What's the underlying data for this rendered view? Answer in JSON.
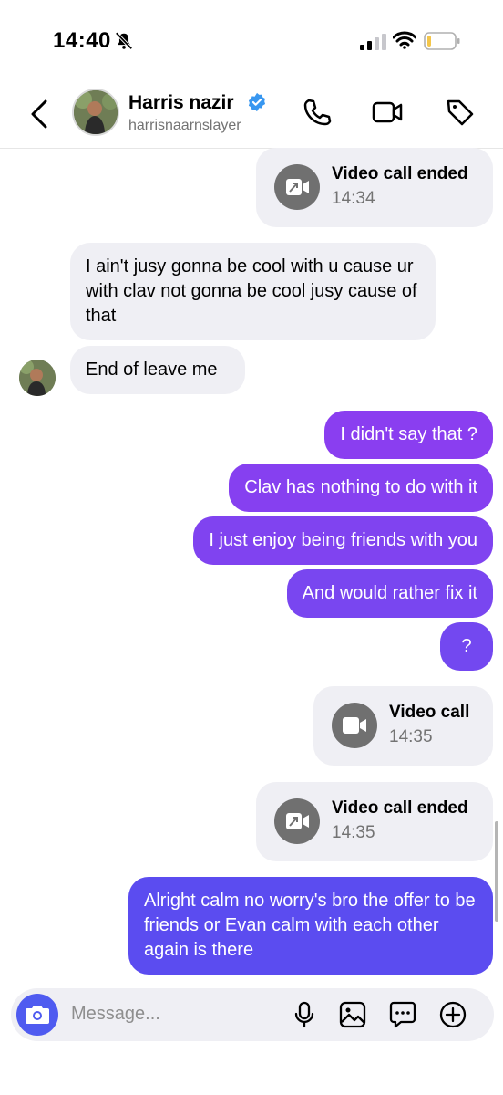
{
  "status_bar": {
    "time": "14:40"
  },
  "header": {
    "name": "Harris nazir",
    "handle": "harrisnaarnslayer"
  },
  "messages": {
    "call1": {
      "title": "Video call ended",
      "time": "14:34"
    },
    "in1": "I ain't jusy gonna be cool with u cause ur with clav not gonna be cool jusy cause of that",
    "in2": "End of leave me",
    "out1": "I didn't say that ?",
    "out2": "Clav has nothing to do with it",
    "out3": "I just enjoy being friends with you",
    "out4": "And would rather fix it",
    "out5": "?",
    "call2": {
      "title": "Video call",
      "time": "14:35"
    },
    "call3": {
      "title": "Video call ended",
      "time": "14:35"
    },
    "out6": "Alright calm no worry's bro the offer to be friends or Evan calm with each other again is there"
  },
  "composer": {
    "placeholder": "Message..."
  },
  "colors": {
    "accent": "#4f5bf0",
    "bubble_out_top": "#8a3ef0",
    "bubble_out_bottom": "#5b4cf0",
    "verified": "#3897f0"
  },
  "icons": [
    "bell-slash-icon",
    "signal-icon",
    "wifi-icon",
    "battery-icon",
    "back-arrow-icon",
    "verified-badge-icon",
    "phone-icon",
    "video-icon",
    "tag-icon",
    "video-call-ended-icon",
    "video-call-icon",
    "camera-icon",
    "microphone-icon",
    "gallery-icon",
    "sticker-icon",
    "plus-icon"
  ]
}
